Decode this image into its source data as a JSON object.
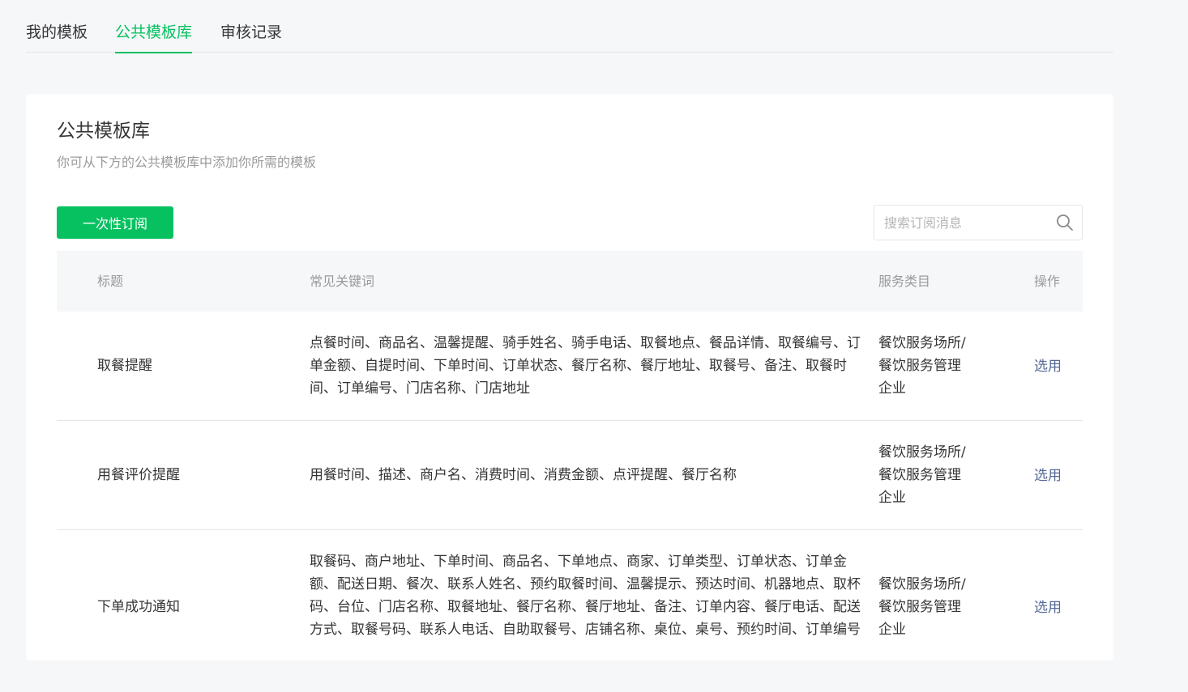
{
  "tabs": [
    {
      "label": "我的模板",
      "active": false
    },
    {
      "label": "公共模板库",
      "active": true
    },
    {
      "label": "审核记录",
      "active": false
    }
  ],
  "panel": {
    "title": "公共模板库",
    "description": "你可从下方的公共模板库中添加你所需的模板",
    "primary_button": "一次性订阅"
  },
  "search": {
    "placeholder": "搜索订阅消息",
    "value": "",
    "icon": "search-icon"
  },
  "table": {
    "headers": {
      "title": "标题",
      "keywords": "常见关键词",
      "category": "服务类目",
      "action": "操作"
    },
    "rows": [
      {
        "title": "取餐提醒",
        "keywords": "点餐时间、商品名、温馨提醒、骑手姓名、骑手电话、取餐地点、餐品详情、取餐编号、订单金额、自提时间、下单时间、订单状态、餐厅名称、餐厅地址、取餐号、备注、取餐时间、订单编号、门店名称、门店地址",
        "category": "餐饮服务场所/餐饮服务管理企业",
        "action": "选用"
      },
      {
        "title": "用餐评价提醒",
        "keywords": "用餐时间、描述、商户名、消费时间、消费金额、点评提醒、餐厅名称",
        "category": "餐饮服务场所/餐饮服务管理企业",
        "action": "选用"
      },
      {
        "title": "下单成功通知",
        "keywords": "取餐码、商户地址、下单时间、商品名、下单地点、商家、订单类型、订单状态、订单金额、配送日期、餐次、联系人姓名、预约取餐时间、温馨提示、预达时间、机器地点、取杯码、台位、门店名称、取餐地址、餐厅名称、餐厅地址、备注、订单内容、餐厅电话、配送方式、取餐号码、联系人电话、自助取餐号、店铺名称、桌位、桌号、预约时间、订单编号",
        "category": "餐饮服务场所/餐饮服务管理企业",
        "action": "选用"
      }
    ]
  },
  "colors": {
    "accent": "#07c160",
    "link": "#576b95",
    "background": "#f6f7f9",
    "muted_text": "#9a9a9a"
  }
}
